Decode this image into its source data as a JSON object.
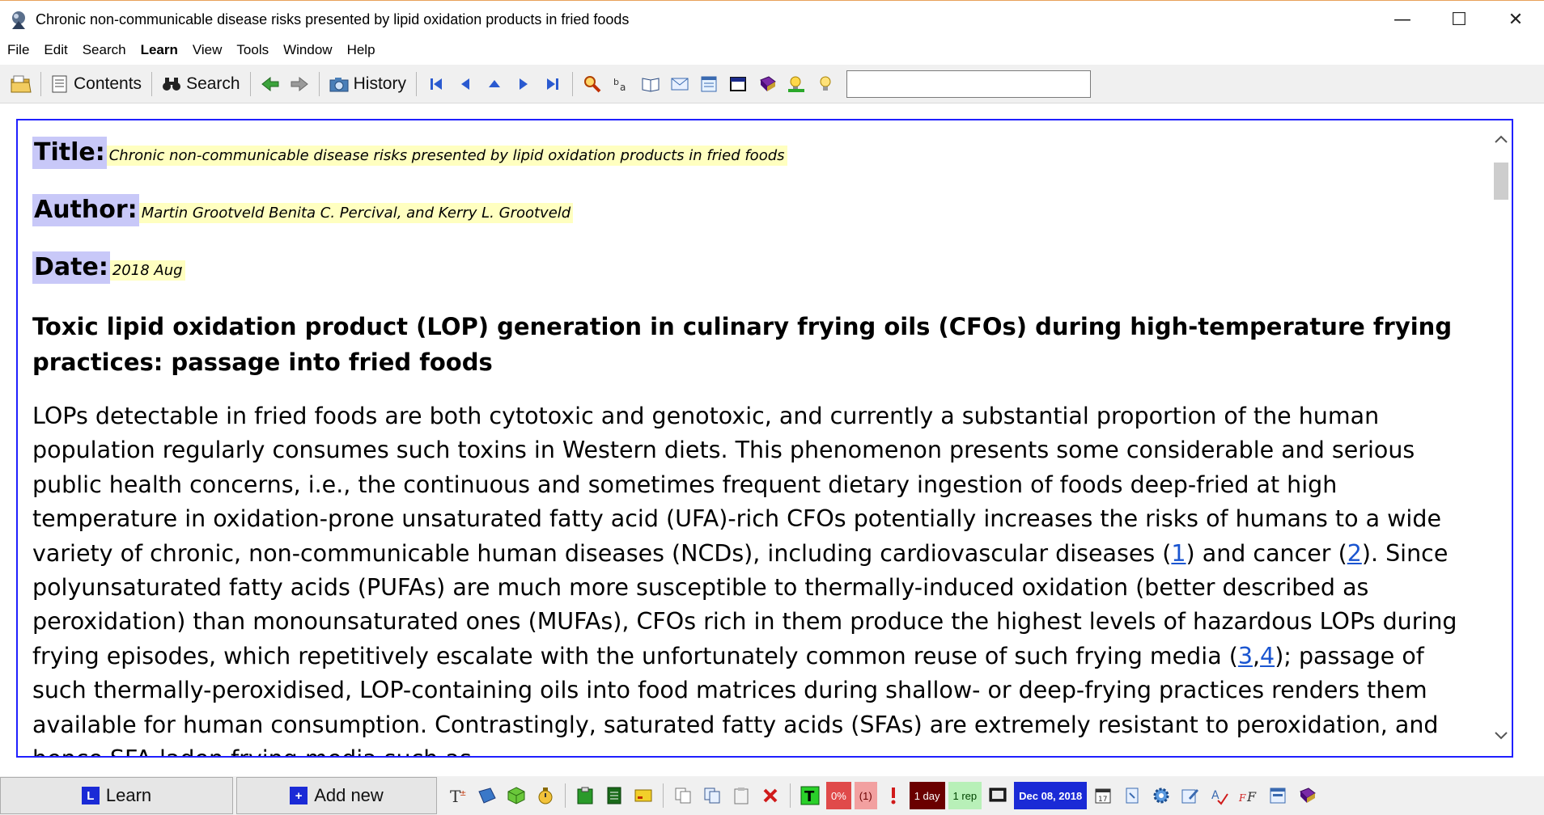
{
  "window": {
    "title": "Chronic non-communicable disease risks presented by lipid oxidation products in fried foods",
    "minimize": "—",
    "maximize": "☐",
    "close": "✕"
  },
  "menu": [
    "File",
    "Edit",
    "Search",
    "Learn",
    "View",
    "Tools",
    "Window",
    "Help"
  ],
  "toolbar": {
    "contents_label": "Contents",
    "search_label": "Search",
    "history_label": "History",
    "search_value": ""
  },
  "article": {
    "title_label": "Title:",
    "title_value": "Chronic non-communicable disease risks presented by lipid oxidation products in fried foods",
    "author_label": "Author:",
    "author_value": "Martin Grootveld Benita C. Percival, and Kerry L. Grootveld",
    "date_label": "Date:",
    "date_value": "2018 Aug",
    "heading": "Toxic lipid oxidation product (LOP) generation in culinary frying oils (CFOs) during high-temperature frying practices: passage into fried foods",
    "para_1": "LOPs detectable in fried foods are both cytotoxic and genotoxic, and currently a substantial proportion of the human population regularly consumes such toxins in Western diets. This phenomenon presents some considerable and serious public health concerns, i.e., the continuous and sometimes frequent dietary ingestion of foods deep-fried at high temperature in oxidation-prone unsaturated fatty acid (UFA)-rich CFOs potentially increases the risks of humans to a wide variety of chronic, non-communicable human diseases (NCDs), including cardiovascular diseases (",
    "ref_1": "1",
    "para_2": ") and cancer (",
    "ref_2": "2",
    "para_3": "). Since polyunsaturated fatty acids (PUFAs) are much more susceptible to thermally-induced oxidation (better described as peroxidation) than monounsaturated ones (MUFAs), CFOs rich in them produce the highest levels of hazardous LOPs during frying episodes, which repetitively escalate with the unfortunately common reuse of such frying media (",
    "ref_3": "3",
    "ref_sep": ",",
    "ref_4": "4",
    "para_4": "); passage of such thermally-peroxidised, LOP-containing oils into food matrices during shallow- or deep-frying practices renders them available for human consumption. Contrastingly, saturated fatty acids (SFAs) are extremely resistant to peroxidation, and hence SFA-laden frying media such as"
  },
  "bottom": {
    "learn_label": "Learn",
    "add_new_label": "Add new",
    "percent_chip": "0%",
    "count_chip": "(1)",
    "interval_chip": "1 day",
    "reps_chip": "1 rep",
    "date_chip": "Dec 08, 2018"
  },
  "colors": {
    "frame_border": "#2020ff",
    "label_bg": "#c8c8f8",
    "value_bg": "#ffffc0",
    "link": "#1a55d0"
  }
}
